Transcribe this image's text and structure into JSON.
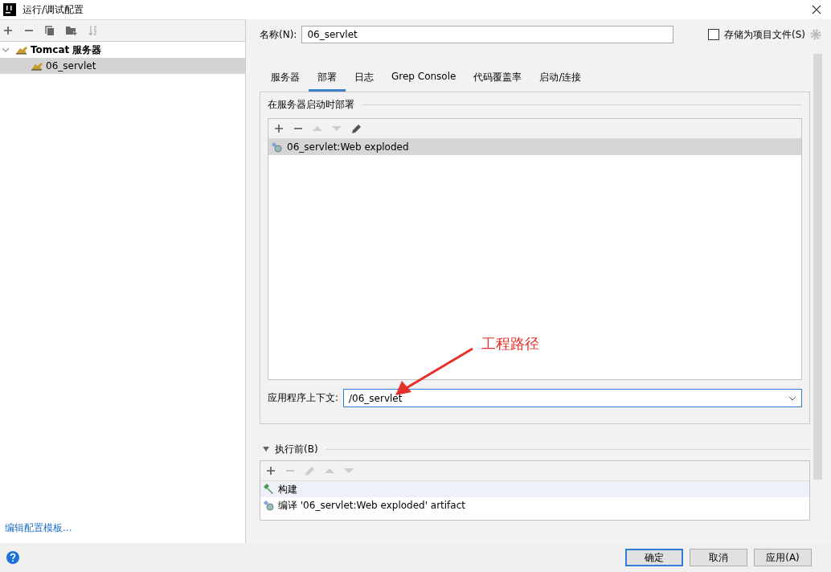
{
  "window": {
    "title": "运行/调试配置"
  },
  "tree": [
    {
      "label": "Tomcat 服务器",
      "expanded": true,
      "children": [
        {
          "label": "06_servlet",
          "selected": true
        }
      ]
    }
  ],
  "edit_templates_link": "编辑配置模板...",
  "name_field": {
    "label": "名称(N):",
    "value": "06_servlet"
  },
  "store_checkbox": {
    "label": "存储为项目文件(S)",
    "checked": false
  },
  "tabs": [
    {
      "label": "服务器",
      "selected": false
    },
    {
      "label": "部署",
      "selected": true
    },
    {
      "label": "日志",
      "selected": false
    },
    {
      "label": "Grep Console",
      "selected": false
    },
    {
      "label": "代码覆盖率",
      "selected": false
    },
    {
      "label": "启动/连接",
      "selected": false
    }
  ],
  "deploy": {
    "title": "在服务器启动时部署",
    "items": [
      {
        "label": "06_servlet:Web exploded",
        "selected": true
      }
    ]
  },
  "context_field": {
    "label": "应用程序上下文:",
    "value": "/06_servlet"
  },
  "annotation": {
    "text": "工程路径"
  },
  "before_launch": {
    "title": "执行前(B)",
    "expanded": true,
    "items": [
      {
        "kind": "build",
        "label": "构建",
        "selected": true
      },
      {
        "kind": "artifact",
        "label": "编译 '06_servlet:Web exploded' artifact",
        "selected": false
      }
    ]
  },
  "buttons": [
    {
      "label": "确定",
      "default": true
    },
    {
      "label": "取消",
      "default": false
    },
    {
      "label": "应用(A)",
      "default": false
    }
  ]
}
